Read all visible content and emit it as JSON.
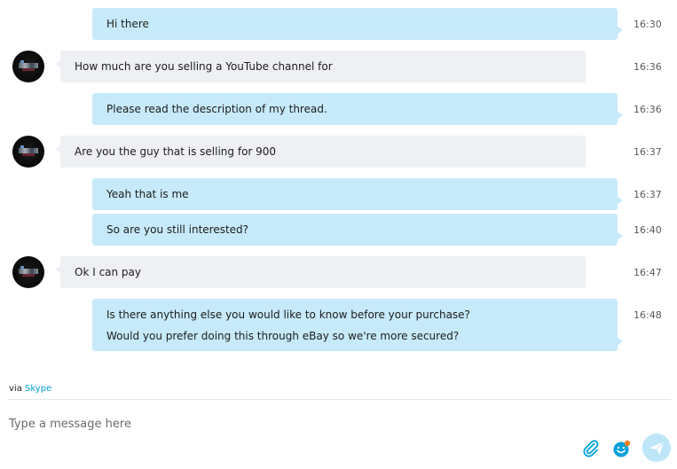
{
  "messages": [
    {
      "direction": "out",
      "text": "Hi there",
      "time": "16:30"
    },
    {
      "direction": "in",
      "text": "How much are you selling a YouTube channel for",
      "time": "16:36"
    },
    {
      "direction": "out",
      "text": "Please read the description of my thread.",
      "time": "16:36"
    },
    {
      "direction": "in",
      "text": "Are you the guy that is selling for 900",
      "time": "16:37"
    },
    {
      "direction": "out",
      "text": "Yeah that is me",
      "time": "16:37"
    },
    {
      "direction": "out",
      "text": "So are you still interested?",
      "time": "16:40"
    },
    {
      "direction": "in",
      "text": "Ok I can pay",
      "time": "16:47"
    },
    {
      "direction": "out",
      "lines": [
        "Is there anything else you would like to know before your purchase?",
        "Would you prefer doing this through eBay so we're more secured?"
      ],
      "time": "16:48"
    }
  ],
  "footer": {
    "via_prefix": "via",
    "via_link": "Skype"
  },
  "compose": {
    "placeholder": "Type a message here",
    "value": ""
  },
  "icons": {
    "attach": "paperclip-icon",
    "emoji": "emoticon-icon",
    "send": "send-icon"
  },
  "colors": {
    "outgoing_bubble": "#c7eafa",
    "incoming_bubble": "#eef0f3",
    "accent": "#00a0dc",
    "send_button": "#bde6f8"
  }
}
